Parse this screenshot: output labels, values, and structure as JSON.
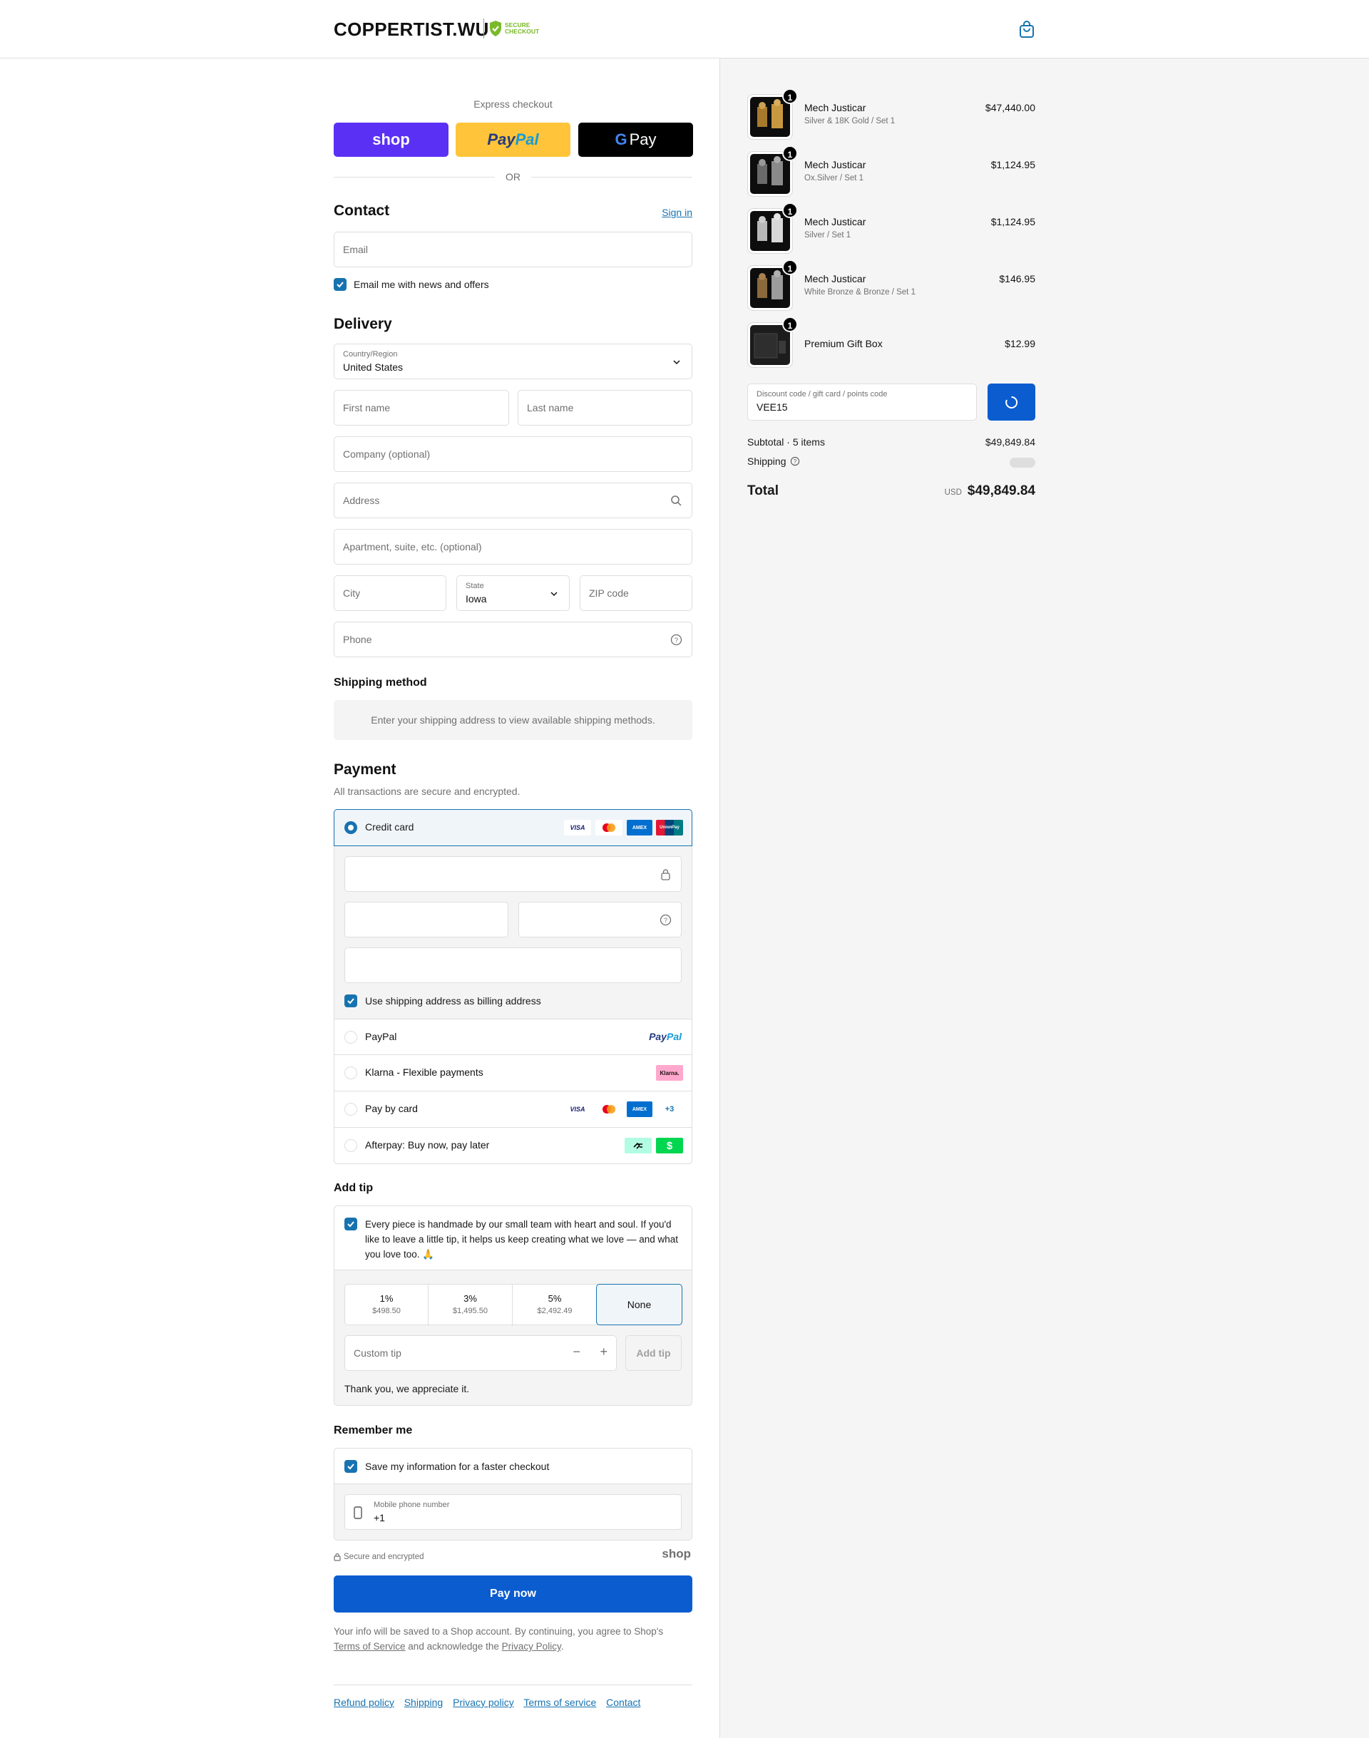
{
  "header": {
    "brand": "COPPERTIST.WU",
    "secure_badge": [
      "SECURE",
      "CHECKOUT"
    ],
    "cart_icon": "shopping-bag-icon",
    "brand_color": "#7ab929"
  },
  "express": {
    "title": "Express checkout",
    "buttons": {
      "shop": "shop",
      "paypal_a": "Pay",
      "paypal_b": "Pal",
      "gpay_g": "G",
      "gpay": "Pay"
    },
    "or": "OR"
  },
  "contact": {
    "heading": "Contact",
    "sign_in": "Sign in",
    "email_placeholder": "Email",
    "news_offers": "Email me with news and offers"
  },
  "delivery": {
    "heading": "Delivery",
    "country_label": "Country/Region",
    "country_value": "United States",
    "first_name": "First name",
    "last_name": "Last name",
    "company": "Company (optional)",
    "address": "Address",
    "apartment": "Apartment, suite, etc. (optional)",
    "city": "City",
    "state_label": "State",
    "state_value": "Iowa",
    "zip": "ZIP code",
    "phone": "Phone"
  },
  "shipping_method": {
    "heading": "Shipping method",
    "notice": "Enter your shipping address to view available shipping methods."
  },
  "payment": {
    "heading": "Payment",
    "subtitle": "All transactions are secure and encrypted.",
    "credit_card": "Credit card",
    "billing_same": "Use shipping address as billing address",
    "options": [
      {
        "label": "PayPal"
      },
      {
        "label": "Klarna - Flexible payments"
      },
      {
        "label": "Pay by card"
      },
      {
        "label": "Afterpay: Buy now, pay later"
      }
    ],
    "card_logos": {
      "visa": "VISA",
      "amex": "AMEX",
      "unionpay": "UnionPay",
      "more": "+3",
      "klarna": "Klarna.",
      "paypal_a": "Pay",
      "paypal_b": "Pal"
    },
    "accent": "#1773b0"
  },
  "tip": {
    "heading": "Add tip",
    "message": "Every piece is handmade by our small team with heart and soul. If you'd like to leave a little tip, it helps us keep creating what we love — and what you love too. 🙏",
    "options": [
      {
        "percent": "1%",
        "amount": "$498.50"
      },
      {
        "percent": "3%",
        "amount": "$1,495.50"
      },
      {
        "percent": "5%",
        "amount": "$2,492.49"
      },
      {
        "percent": "None",
        "amount": ""
      }
    ],
    "selected_index": 3,
    "custom_placeholder": "Custom tip",
    "add_button": "Add tip",
    "thanks": "Thank you, we appreciate it."
  },
  "remember": {
    "heading": "Remember me",
    "save_info": "Save my information for a faster checkout",
    "phone_label": "Mobile phone number",
    "phone_value": "+1"
  },
  "footer": {
    "secure_text": "Secure and encrypted",
    "shop_logo": "shop",
    "pay_now": "Pay now",
    "legal_a": "Your info will be saved to a Shop account. By continuing, you agree to Shop's",
    "terms": "Terms of Service",
    "legal_b": "and acknowledge the",
    "privacy": "Privacy Policy",
    "legal_c": ".",
    "links": [
      "Refund policy",
      "Shipping",
      "Privacy policy",
      "Terms of service",
      "Contact"
    ]
  },
  "summary": {
    "items": [
      {
        "name": "Mech Justicar",
        "variant": "Silver & 18K Gold / Set 1",
        "price": "$47,440.00",
        "qty": "1"
      },
      {
        "name": "Mech Justicar",
        "variant": "Ox.Silver / Set 1",
        "price": "$1,124.95",
        "qty": "1"
      },
      {
        "name": "Mech Justicar",
        "variant": "Silver / Set 1",
        "price": "$1,124.95",
        "qty": "1"
      },
      {
        "name": "Mech Justicar",
        "variant": "White Bronze & Bronze / Set 1",
        "price": "$146.95",
        "qty": "1"
      },
      {
        "name": "Premium Gift Box",
        "variant": "",
        "price": "$12.99",
        "qty": "1"
      }
    ],
    "discount_label": "Discount code / gift card / points code",
    "discount_value": "VEE15",
    "subtotal_label": "Subtotal · 5 items",
    "subtotal_value": "$49,849.84",
    "shipping_label": "Shipping",
    "total_label": "Total",
    "currency": "USD",
    "total_value": "$49,849.84"
  }
}
